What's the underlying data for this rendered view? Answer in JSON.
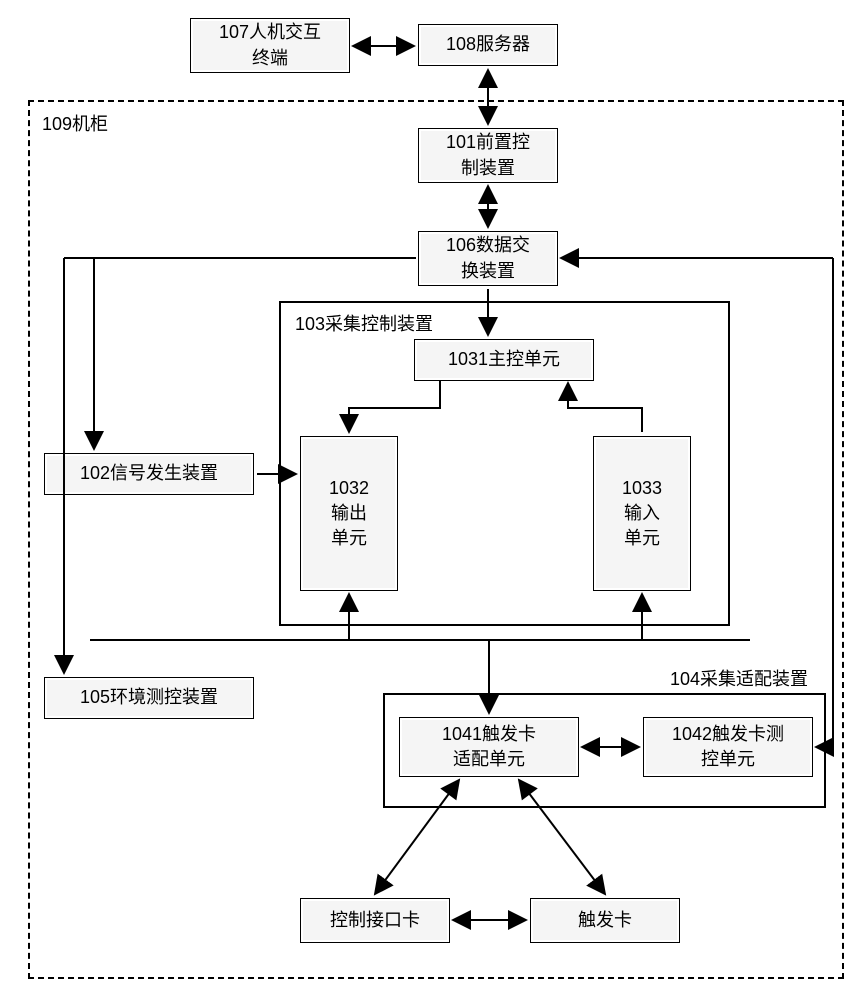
{
  "nodes": {
    "n107": "107人机交互\n终端",
    "n108": "108服务器",
    "n101": "101前置控\n制装置",
    "n106": "106数据交\n换装置",
    "n109_label": "109机柜",
    "n102": "102信号发生装置",
    "n105": "105环境测控装置",
    "n103_label": "103采集控制装置",
    "n1031": "1031主控单元",
    "n1032": "1032\n输出\n单元",
    "n1033": "1033\n输入\n单元",
    "n104_label": "104采集适配装置",
    "n1041": "1041触发卡\n适配单元",
    "n1042": "1042触发卡测\n控单元",
    "nCtrl": "控制接口卡",
    "nTrig": "触发卡"
  }
}
